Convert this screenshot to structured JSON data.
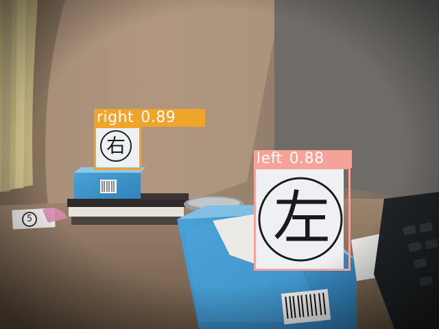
{
  "detections": [
    {
      "label": "right",
      "score": "0.89",
      "color": "#f0a52a"
    },
    {
      "label": "left",
      "score": "0.88",
      "color": "#f5a299"
    }
  ],
  "sign_glyphs": {
    "right_sign": "右",
    "left_sign": "左",
    "chip": "5"
  },
  "colors": {
    "wall": "#d8d2c8",
    "desk": "#a08262",
    "tissue_box": "#3c8fc7"
  }
}
